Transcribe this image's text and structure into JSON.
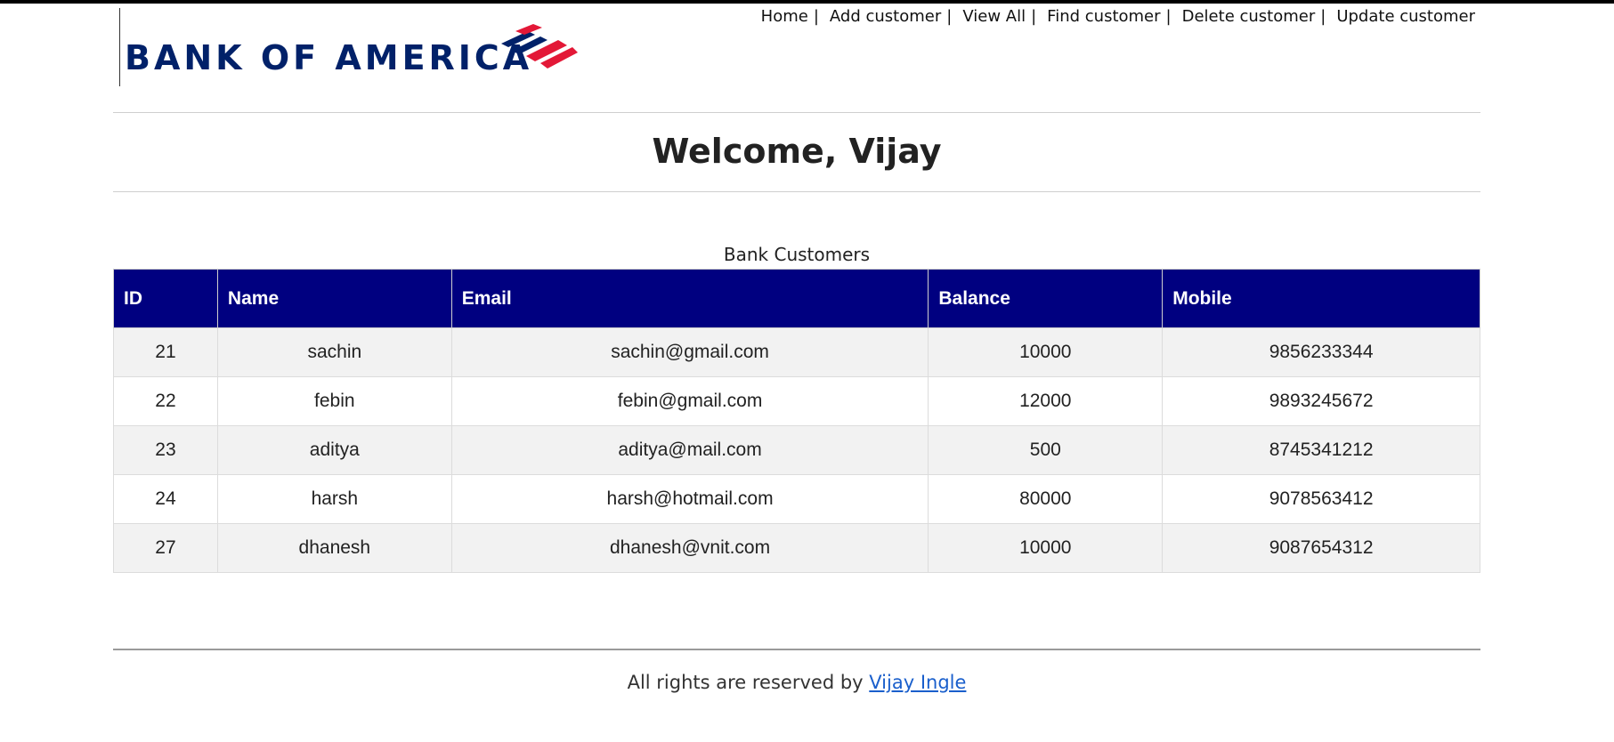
{
  "brand": {
    "name": "BANK OF AMERICA",
    "logo_icon": "bank-of-america-flag-icon"
  },
  "nav": {
    "items": [
      {
        "label": "Home"
      },
      {
        "label": "Add customer"
      },
      {
        "label": "View All"
      },
      {
        "label": "Find customer"
      },
      {
        "label": "Delete customer"
      },
      {
        "label": "Update customer"
      }
    ],
    "separator": "|"
  },
  "welcome": {
    "text": "Welcome, Vijay"
  },
  "table": {
    "caption": "Bank Customers",
    "columns": [
      "ID",
      "Name",
      "Email",
      "Balance",
      "Mobile"
    ],
    "rows": [
      [
        "21",
        "sachin",
        "sachin@gmail.com",
        "10000",
        "9856233344"
      ],
      [
        "22",
        "febin",
        "febin@gmail.com",
        "12000",
        "9893245672"
      ],
      [
        "23",
        "aditya",
        "aditya@mail.com",
        "500",
        "8745341212"
      ],
      [
        "24",
        "harsh",
        "harsh@hotmail.com",
        "80000",
        "9078563412"
      ],
      [
        "27",
        "dhanesh",
        "dhanesh@vnit.com",
        "10000",
        "9087654312"
      ]
    ],
    "header_color": "#000080",
    "stripe_color": "#f2f2f2"
  },
  "footer": {
    "prefix": "All rights are reserved by",
    "author_link": "Vijay Ingle",
    "link_color": "#1a5fcc"
  },
  "colors": {
    "brand_blue": "#012169",
    "brand_red": "#e31837"
  }
}
